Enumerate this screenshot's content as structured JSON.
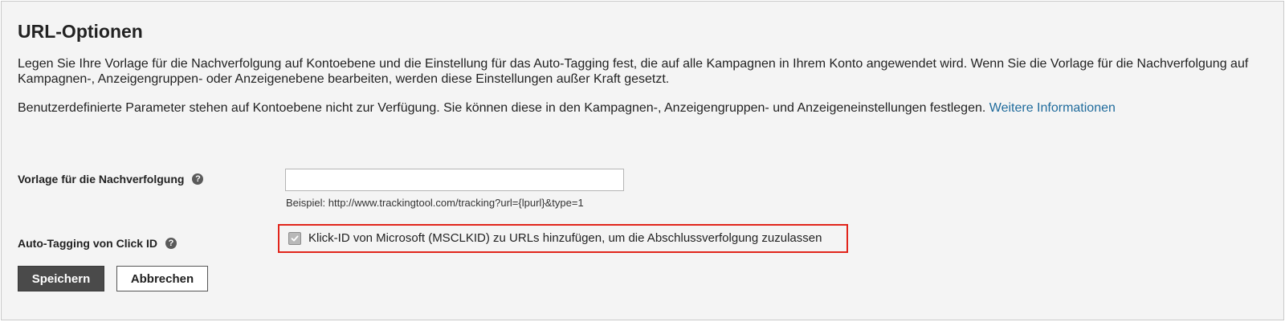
{
  "page": {
    "title": "URL-Optionen",
    "paragraph1": "Legen Sie Ihre Vorlage für die Nachverfolgung auf Kontoebene und die Einstellung für das Auto-Tagging fest, die auf alle Kampagnen in Ihrem Konto angewendet wird. Wenn Sie die Vorlage für die Nachverfolgung auf Kampagnen-, Anzeigengruppen- oder Anzeigenebene bearbeiten, werden diese Einstellungen außer Kraft gesetzt.",
    "paragraph2": "Benutzerdefinierte Parameter stehen auf Kontoebene nicht zur Verfügung. Sie können diese in den Kampagnen-, Anzeigengruppen- und Anzeigeneinstellungen festlegen.",
    "more_info_link": "Weitere Informationen"
  },
  "tracking": {
    "label": "Vorlage für die Nachverfolgung",
    "help_glyph": "?",
    "value": "",
    "example": "Beispiel: http://www.trackingtool.com/tracking?url={lpurl}&type=1"
  },
  "auto_tagging": {
    "label": "Auto-Tagging von Click ID",
    "help_glyph": "?",
    "checkbox_label": "Klick-ID von Microsoft (MSCLKID) zu URLs hinzufügen, um die Abschlussverfolgung zuzulassen",
    "checked": true
  },
  "buttons": {
    "save": "Speichern",
    "cancel": "Abbrechen"
  },
  "colors": {
    "background": "#f4f4f4",
    "link": "#1f6b9c",
    "highlight": "#e1251b",
    "save_button": "#4a4a4a"
  },
  "icons": {
    "help": "help-icon",
    "check": "check-icon"
  }
}
